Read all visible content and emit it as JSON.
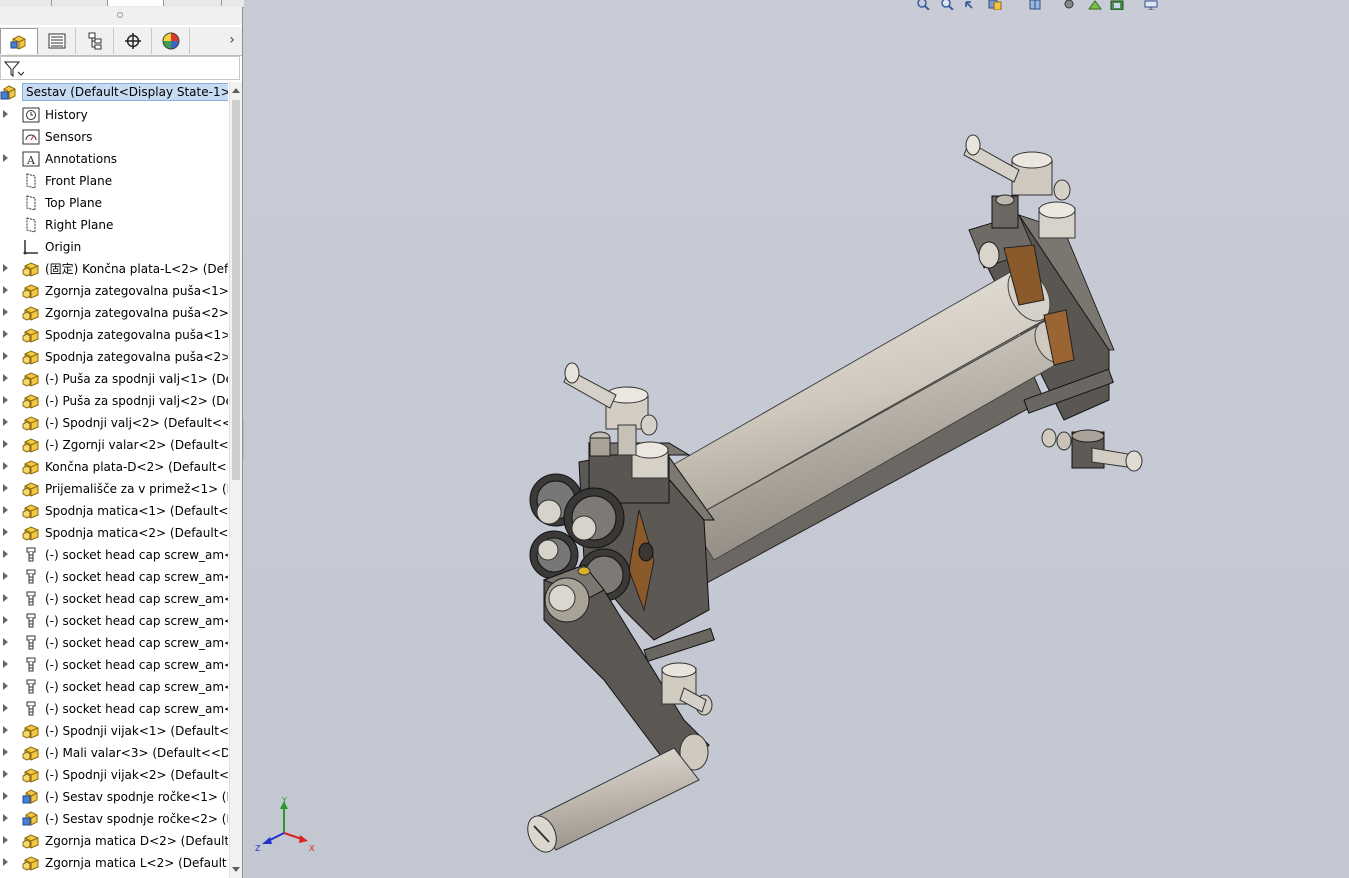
{
  "tree": {
    "root": {
      "label": "Sestav  (Default<Display State-1>)"
    },
    "items": [
      {
        "label": "History",
        "icon": "history-icon",
        "expandable": true
      },
      {
        "label": "Sensors",
        "icon": "sensors-icon",
        "expandable": false
      },
      {
        "label": "Annotations",
        "icon": "annotations-icon",
        "expandable": true
      },
      {
        "label": "Front Plane",
        "icon": "plane-icon",
        "expandable": false
      },
      {
        "label": "Top Plane",
        "icon": "plane-icon",
        "expandable": false
      },
      {
        "label": "Right Plane",
        "icon": "plane-icon",
        "expandable": false
      },
      {
        "label": "Origin",
        "icon": "origin-icon",
        "expandable": false
      },
      {
        "label": "(固定) Končna plata-L<2> (Defa",
        "icon": "part-icon",
        "expandable": true
      },
      {
        "label": "Zgornja zategovalna puša<1> (",
        "icon": "part-icon",
        "expandable": true
      },
      {
        "label": "Zgornja zategovalna puša<2> (",
        "icon": "part-icon",
        "expandable": true
      },
      {
        "label": "Spodnja zategovalna puša<1>",
        "icon": "part-icon",
        "expandable": true
      },
      {
        "label": "Spodnja zategovalna puša<2>",
        "icon": "part-icon",
        "expandable": true
      },
      {
        "label": "(-) Puša za spodnji valj<1> (Def",
        "icon": "part-icon",
        "expandable": true
      },
      {
        "label": "(-) Puša za spodnji valj<2> (Def",
        "icon": "part-icon",
        "expandable": true
      },
      {
        "label": "(-) Spodnji valj<2> (Default<<D",
        "icon": "part-icon",
        "expandable": true
      },
      {
        "label": "(-) Zgornji valar<2> (Default<<",
        "icon": "part-icon",
        "expandable": true
      },
      {
        "label": "Končna plata-D<2> (Default<<",
        "icon": "part-icon",
        "expandable": true
      },
      {
        "label": "Prijemališče za v primež<1> (D",
        "icon": "part-icon",
        "expandable": true
      },
      {
        "label": "Spodnja matica<1> (Default<<",
        "icon": "part-icon",
        "expandable": true
      },
      {
        "label": "Spodnja matica<2> (Default<<",
        "icon": "part-icon",
        "expandable": true
      },
      {
        "label": "(-) socket head cap screw_am<",
        "icon": "screw-icon",
        "expandable": true
      },
      {
        "label": "(-) socket head cap screw_am<",
        "icon": "screw-icon",
        "expandable": true
      },
      {
        "label": "(-) socket head cap screw_am<",
        "icon": "screw-icon",
        "expandable": true
      },
      {
        "label": "(-) socket head cap screw_am<",
        "icon": "screw-icon",
        "expandable": true
      },
      {
        "label": "(-) socket head cap screw_am<",
        "icon": "screw-icon",
        "expandable": true
      },
      {
        "label": "(-) socket head cap screw_am<",
        "icon": "screw-icon",
        "expandable": true
      },
      {
        "label": "(-) socket head cap screw_am<",
        "icon": "screw-icon",
        "expandable": true
      },
      {
        "label": "(-) socket head cap screw_am<",
        "icon": "screw-icon",
        "expandable": true
      },
      {
        "label": "(-) Spodnji vijak<1> (Default<<",
        "icon": "part-icon",
        "expandable": true
      },
      {
        "label": "(-) Mali valar<3> (Default<<De",
        "icon": "part-icon",
        "expandable": true
      },
      {
        "label": "(-) Spodnji vijak<2> (Default<<",
        "icon": "part-icon",
        "expandable": true
      },
      {
        "label": "(-) Sestav spodnje ročke<1> (D",
        "icon": "subassembly-icon",
        "expandable": true
      },
      {
        "label": "(-) Sestav spodnje ročke<2> (D",
        "icon": "subassembly-icon",
        "expandable": true
      },
      {
        "label": "Zgornja matica D<2> (Default<",
        "icon": "part-icon",
        "expandable": true
      },
      {
        "label": "Zgornja matica L<2> (Default<<",
        "icon": "part-icon",
        "expandable": true
      }
    ]
  },
  "manager_tabs": [
    {
      "name": "tab-feature-manager",
      "icon": "assembly-icon",
      "active": true
    },
    {
      "name": "tab-property-manager",
      "icon": "property-list-icon",
      "active": false
    },
    {
      "name": "tab-configuration-manager",
      "icon": "configuration-icon",
      "active": false
    },
    {
      "name": "tab-dimxpert-manager",
      "icon": "crosshair-icon",
      "active": false
    },
    {
      "name": "tab-display-manager",
      "icon": "appearance-pie-icon",
      "active": false
    }
  ],
  "triad": {
    "x": "X",
    "y": "Y",
    "z": "Z"
  },
  "colors": {
    "viewport_bg": "#c8ccd6",
    "part_yellow": "#f2c744",
    "frame_dark": "#5a5652",
    "roller_light": "#d9d4cc",
    "selection": "#c7dcf3"
  }
}
